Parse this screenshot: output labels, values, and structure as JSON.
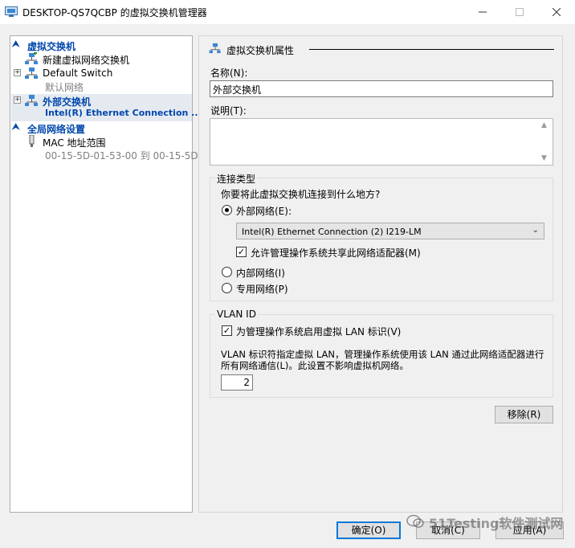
{
  "window": {
    "title": "DESKTOP-QS7QCBP 的虚拟交换机管理器"
  },
  "tree": {
    "virtual_switch_category": "虚拟交换机",
    "new_switch": "新建虚拟网络交换机",
    "default_switch": {
      "name": "Default Switch",
      "sub": "默认网络"
    },
    "external_switch": {
      "name": "外部交换机",
      "sub": "Intel(R) Ethernet Connection ..."
    },
    "global_category": "全局网络设置",
    "mac_range": {
      "name": "MAC 地址范围",
      "sub": "00-15-5D-01-53-00 到 00-15-5D-0..."
    }
  },
  "properties": {
    "section_title": "虚拟交换机属性",
    "name_label": "名称(N):",
    "name_value": "外部交换机",
    "notes_label": "说明(T):",
    "notes_value": "",
    "connection_type": {
      "group_title": "连接类型",
      "question": "你要将此虚拟交换机连接到什么地方?",
      "external_label": "外部网络(E):",
      "adapter_selected": "Intel(R) Ethernet Connection (2) I219-LM",
      "allow_share_label": "允许管理操作系统共享此网络适配器(M)",
      "internal_label": "内部网络(I)",
      "private_label": "专用网络(P)",
      "selected": "external"
    },
    "vlan": {
      "group_title": "VLAN ID",
      "enable_label": "为管理操作系统启用虚拟 LAN 标识(V)",
      "description_line1": "VLAN 标识符指定虚拟 LAN，管理操作系统使用该 LAN 通过此网络适配器进行",
      "description_line2": "所有网络通信(L)。此设置不影响虚拟机网络。",
      "vlan_id_value": "2"
    },
    "remove_button": "移除(R)"
  },
  "footer": {
    "ok_button": "确定(O)",
    "cancel_button": "取消(C)",
    "apply_button": "应用(A)"
  },
  "watermark": {
    "text": "51Testing软件测试网"
  },
  "colors": {
    "accent": "#0047ab",
    "selection_bg": "#e5eaf1",
    "dialog_bg": "#f0f0f0"
  }
}
